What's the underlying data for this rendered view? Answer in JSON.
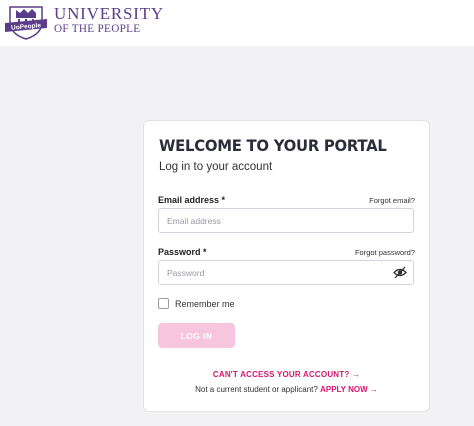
{
  "header": {
    "logo_badge": "UoPeople",
    "logo_line1": "UNIVERSITY",
    "logo_line2": "OF THE PEOPLE"
  },
  "card": {
    "title": "WELCOME TO YOUR PORTAL",
    "subtitle": "Log in to your account",
    "email": {
      "label": "Email address *",
      "forgot_label": "Forgot email?",
      "placeholder": "Email address",
      "value": ""
    },
    "password": {
      "label": "Password *",
      "forgot_label": "Forgot password?",
      "placeholder": "Password",
      "value": ""
    },
    "remember_label": "Remember me",
    "remember_checked": false,
    "login_label": "LOG IN",
    "cant_access_label": "CAN'T ACCESS YOUR ACCOUNT?",
    "cant_access_arrow": "→",
    "not_current_text": "Not a current student or applicant?",
    "apply_label": "APPLY NOW",
    "apply_arrow": "→"
  },
  "colors": {
    "brand_purple": "#5b3d8a",
    "accent_pink": "#d6166f",
    "login_button_disabled": "#f7c6dc",
    "page_background": "#f2f1f4"
  },
  "icons": {
    "logo": "university-shield-icon",
    "password_toggle": "eye-slash-icon"
  }
}
